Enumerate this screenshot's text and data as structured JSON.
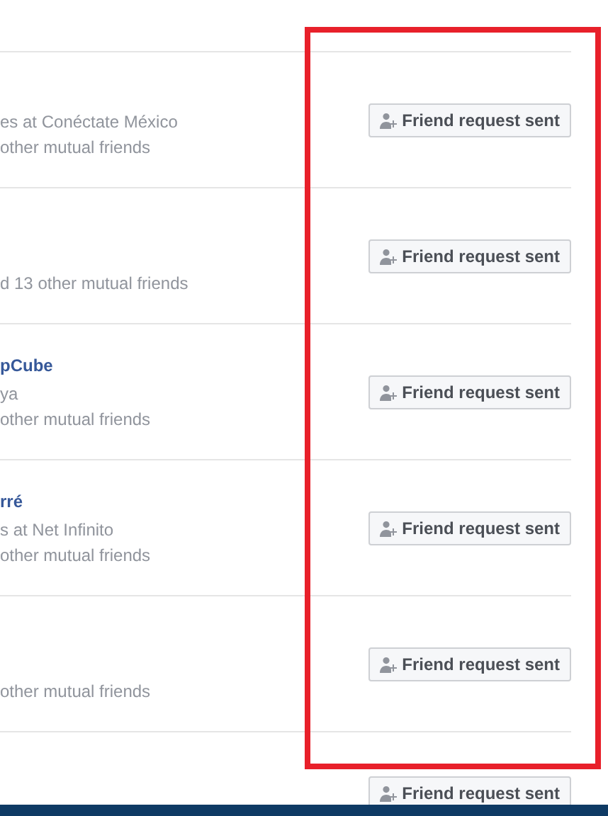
{
  "people": [
    {
      "detail": "es at Conéctate México",
      "mutual": "other mutual friends",
      "button": "Friend request sent"
    },
    {
      "mutual": "d 13 other mutual friends",
      "button": "Friend request sent"
    },
    {
      "name": "pCube",
      "detail": "ya",
      "mutual": "other mutual friends",
      "button": "Friend request sent"
    },
    {
      "name": "rré",
      "detail": "s at Net Infinito",
      "mutual": "other mutual friends",
      "button": "Friend request sent"
    },
    {
      "mutual": "other mutual friends",
      "button": "Friend request sent"
    },
    {
      "button": "Friend request sent"
    }
  ],
  "annotation": {
    "kind": "rectangle"
  }
}
